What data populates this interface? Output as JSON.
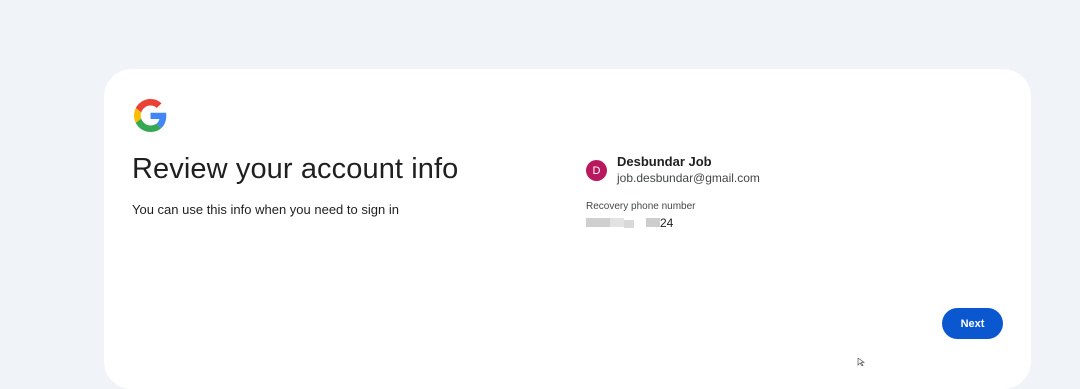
{
  "header": {
    "logo_icon": "google-g-logo"
  },
  "main": {
    "title": "Review your account info",
    "subtitle": "You can use this info when you need to sign in"
  },
  "account": {
    "avatar_letter": "D",
    "avatar_color": "#b8195e",
    "name": "Desbundar Job",
    "email": "job.desbundar@gmail.com"
  },
  "recovery": {
    "label": "Recovery phone number",
    "visible_digits": "24"
  },
  "actions": {
    "next_label": "Next",
    "next_color": "#0b57d0"
  },
  "colors": {
    "background": "#f0f4f9",
    "card": "#ffffff"
  }
}
